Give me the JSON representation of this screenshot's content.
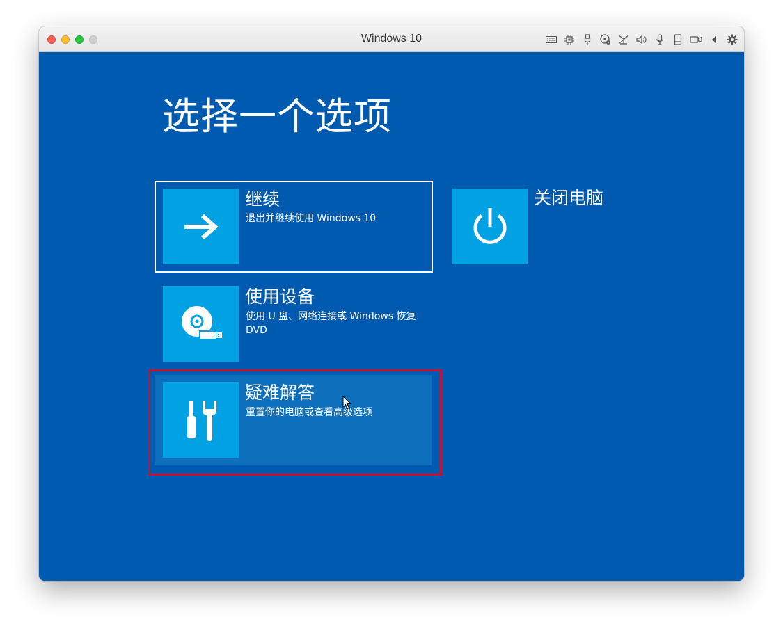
{
  "window": {
    "title": "Windows 10"
  },
  "titlebar_icons": [
    "keyboard-icon",
    "cpu-icon",
    "usb-icon",
    "cd-icon",
    "network-icon",
    "speaker-icon",
    "microphone-icon",
    "disk-icon",
    "camera-icon",
    "arrow-left-icon",
    "gear-icon"
  ],
  "screen": {
    "heading": "选择一个选项",
    "options": [
      {
        "title": "继续",
        "description": "退出并继续使用 Windows 10",
        "icon": "arrow-right-icon"
      },
      {
        "title": "使用设备",
        "description": "使用 U 盘、网络连接或 Windows 恢复 DVD",
        "icon": "disc-usb-icon"
      },
      {
        "title": "疑难解答",
        "description": "重置你的电脑或查看高级选项",
        "icon": "tools-icon"
      },
      {
        "title": "关闭电脑",
        "icon": "power-icon"
      }
    ]
  },
  "colors": {
    "background": "#005bb0",
    "tile": "#00a2e3",
    "hover": "#0e70bd",
    "highlight": "#c8102e"
  }
}
